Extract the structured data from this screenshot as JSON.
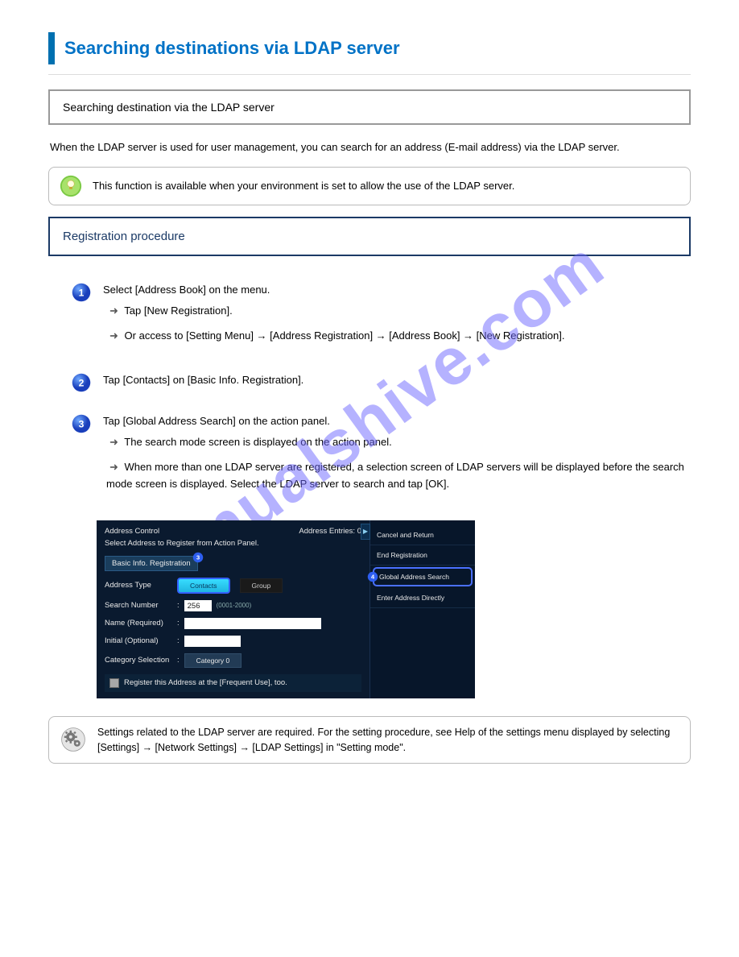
{
  "header": {
    "title": "Searching destinations via LDAP server"
  },
  "gray_box": {
    "text": "Searching destination via the LDAP server"
  },
  "intro": "When the LDAP server is used for user management, you can search for an address (E-mail address) via the LDAP server.",
  "tip": {
    "text": "This function is available when your environment is set to allow the use of the LDAP server."
  },
  "navy_box": {
    "text": "Registration procedure"
  },
  "steps": [
    {
      "num": "1",
      "lines": [
        {
          "text": "Select [Address Book] on the menu."
        },
        {
          "text": "Tap [New Registration]."
        },
        {
          "text": "Or access to [Setting Menu] → [Address Registration] → [Address Book] → [New Registration]."
        }
      ],
      "arrow": "➜"
    },
    {
      "num": "2",
      "lines": [
        {
          "text": "Tap [Contacts] on [Basic Info. Registration]."
        }
      ]
    },
    {
      "num": "3",
      "lines": [
        {
          "text": "Tap [Global Address Search] on the action panel."
        },
        {
          "text": "The search mode screen is displayed on the action panel."
        },
        {
          "text": "When more than one LDAP server are registered, a selection screen of LDAP servers will be displayed before the search mode screen is displayed. Select the LDAP server to search and tap [OK]."
        }
      ]
    }
  ],
  "screenshot": {
    "left": {
      "top_title": "Address Control",
      "entries": "Address Entries: 0",
      "subtitle": "Select Address to Register from Action Panel.",
      "tab": "Basic Info. Registration",
      "rows": {
        "address_type": {
          "label": "Address Type",
          "contacts": "Contacts",
          "group": "Group"
        },
        "search_number": {
          "label": "Search Number",
          "colon": ":",
          "value": "256",
          "hint": "(0001-2000)"
        },
        "name": {
          "label": "Name (Required)",
          "colon": ":"
        },
        "initial": {
          "label": "Initial (Optional)",
          "colon": ":"
        },
        "category": {
          "label": "Category Selection",
          "colon": ":",
          "button": "Category 0"
        },
        "freq": "Register this Address at the [Frequent Use], too."
      }
    },
    "right": {
      "toggle": "▶",
      "items": [
        "Cancel and Return",
        "End Registration",
        "Global Address Search",
        "Enter Address Directly"
      ]
    },
    "badges": {
      "3": "3",
      "4": "4"
    }
  },
  "gear": {
    "text": "Settings related to the LDAP server are required. For the setting procedure, see Help of the settings menu displayed by selecting [Settings] → [Network Settings] → [LDAP Settings] in \"Setting mode\"."
  },
  "watermark": "manualshive.com"
}
